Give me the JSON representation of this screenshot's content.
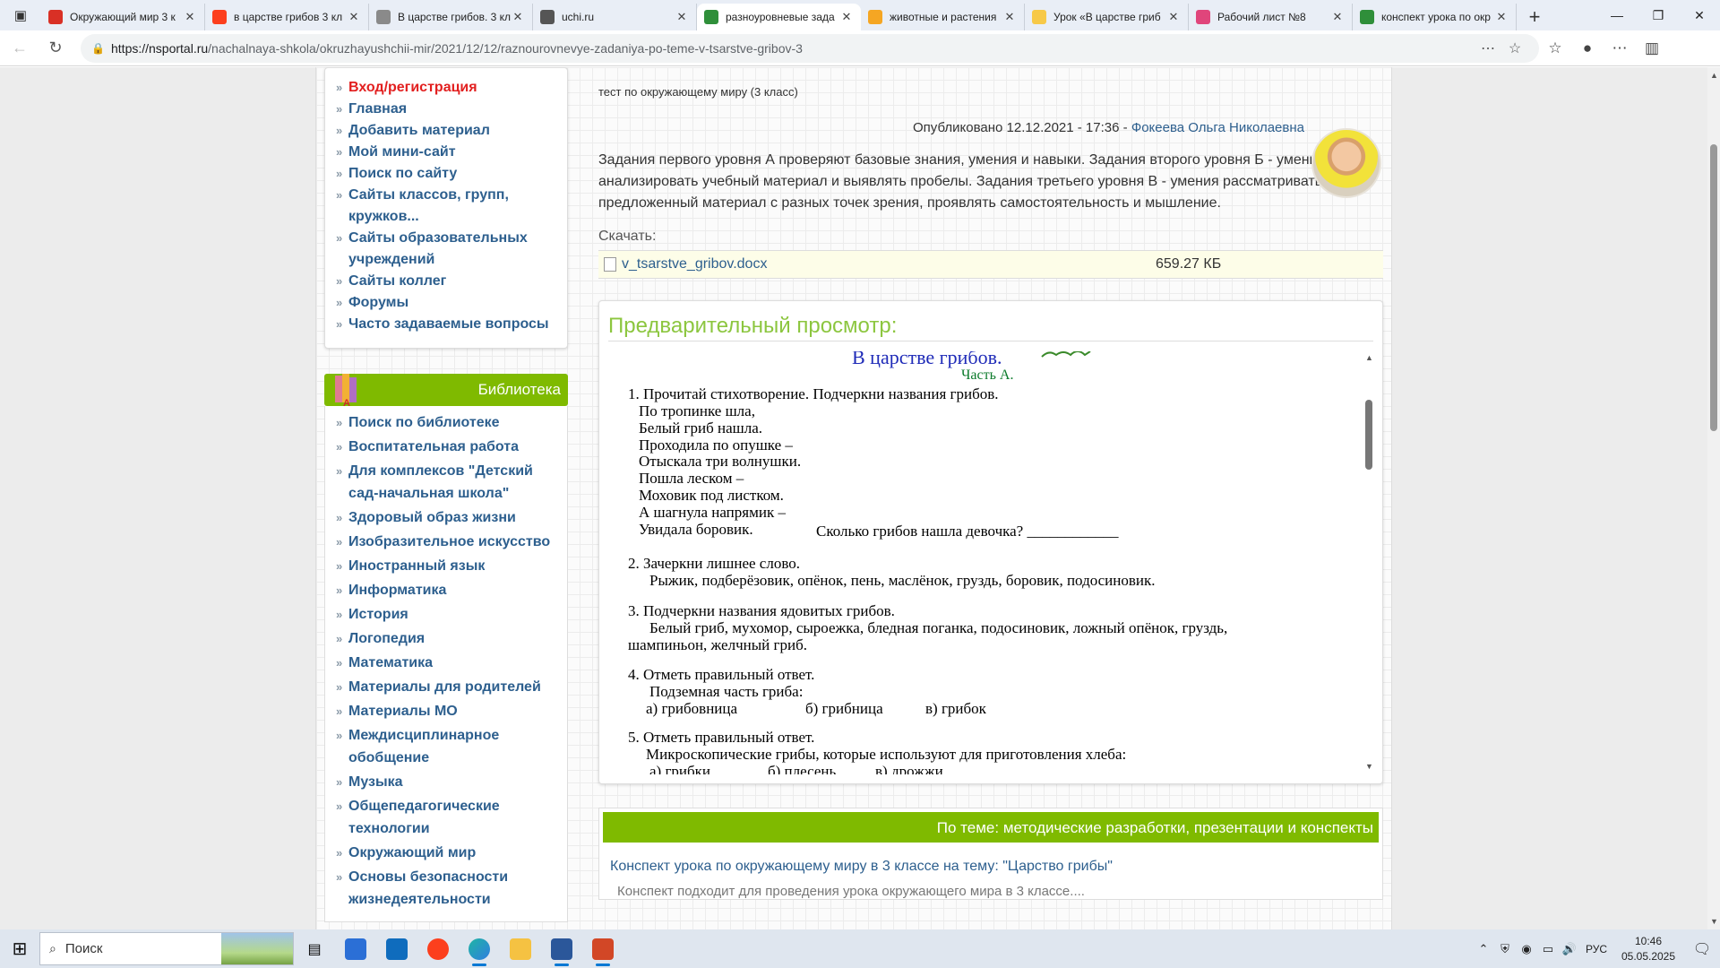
{
  "browser": {
    "tabs": [
      {
        "title": "Окружающий мир 3 к",
        "color": "#d93025",
        "active": false
      },
      {
        "title": "в царстве грибов 3 кл",
        "color": "#fc3f1d",
        "active": false
      },
      {
        "title": "В царстве грибов. 3 кл",
        "color": "#8a8a8a",
        "active": false
      },
      {
        "title": "uchi.ru",
        "color": "#555555",
        "active": false
      },
      {
        "title": "разноуровневые зада",
        "color": "#2f8f3a",
        "active": true
      },
      {
        "title": "животные и растения",
        "color": "#f5a623",
        "active": false
      },
      {
        "title": "Урок «В царстве гриб",
        "color": "#f7c948",
        "active": false
      },
      {
        "title": "Рабочий лист №8",
        "color": "#e0457b",
        "active": false
      },
      {
        "title": "конспект урока по окр",
        "color": "#2f8f3a",
        "active": false
      }
    ],
    "url_host": "https://nsportal.ru",
    "url_path": "/nachalnaya-shkola/okruzhayushchii-mir/2021/12/12/raznourovnevye-zadaniya-po-teme-v-tsarstve-gribov-3"
  },
  "sidebar": {
    "menu": [
      "Вход/регистрация",
      "Главная",
      "Добавить материал",
      "Мой мини-сайт",
      "Поиск по сайту",
      "Сайты классов, групп,",
      "кружков...",
      "Сайты образовательных",
      "учреждений",
      "Сайты коллег",
      "Форумы",
      "Часто задаваемые вопросы"
    ],
    "library_title": "Библиотека",
    "library": [
      "Поиск по библиотеке",
      "Воспитательная работа",
      "Для комплексов \"Детский сад-начальная школа\"",
      "Здоровый образ жизни",
      "Изобразительное искусство",
      "Иностранный язык",
      "Информатика",
      "История",
      "Логопедия",
      "Математика",
      "Материалы для родителей",
      "Материалы МО",
      "Междисциплинарное обобщение",
      "Музыка",
      "Общепедагогические технологии",
      "Окружающий мир",
      "Основы безопасности жизнедеятельности"
    ]
  },
  "main": {
    "subtitle": "тест по окружающему миру (3 класс)",
    "published": "Опубликовано 12.12.2021 - 17:36 - ",
    "author": "Фокеева Ольга Николаевна",
    "description": "Задания первого уровня А проверяют базовые знания, умения и навыки. Задания второго уровня Б - умения анализировать учебный материал и выявлять пробелы. Задания третьего уровня В - умения рассматривать предложенный материал с разных точек зрения, проявлять самостоятельность и мышление.",
    "download_label": "Скачать:",
    "file_name": "v_tsarstve_gribov.docx",
    "file_size": "659.27 КБ",
    "preview_title": "Предварительный просмотр:",
    "doc": {
      "title": "В царстве грибов.",
      "part": "Часть А.",
      "q1": "1. Прочитай стихотворение. Подчеркни названия грибов.",
      "poem": [
        "По тропинке шла,",
        "Белый гриб нашла.",
        "Проходила по опушке –",
        "Отыскала три волнушки.",
        "Пошла леском –",
        "Моховик под листком.",
        "А шагнула напрямик –",
        "Увидала боровик."
      ],
      "q1_tail": "Сколько грибов нашла девочка? ____________",
      "q2": "2. Зачеркни лишнее слово.",
      "q2_text": "Рыжик, подберёзовик, опёнок, пень, маслёнок, груздь, боровик, подосиновик.",
      "q3": "3. Подчеркни названия ядовитых грибов.",
      "q3_text": "Белый гриб, мухомор, сыроежка, бледная поганка, подосиновик, ложный опёнок, груздь,",
      "q3_text2": "шампиньон, желчный гриб.",
      "q4": "4. Отметь правильный ответ.",
      "q4_text": "Подземная часть гриба:",
      "q4_a": "а) грибовница",
      "q4_b": "б) грибница",
      "q4_c": "в) грибок",
      "q5": "5. Отметь правильный ответ.",
      "q5_text": "Микроскопические грибы, которые используют для приготовления хлеба:",
      "q5_a": "а) грибки",
      "q5_b": "б) плесень",
      "q5_c": "в) дрожжи"
    },
    "topic_title": "По теме: методические разработки, презентации и конспекты",
    "topic_link": "Конспект урока по окружающему миру в 3 классе на тему: \"Царство грибы\"",
    "topic_desc": "Конспект подходит для проведения урока окружающего мира в 3 классе...."
  },
  "taskbar": {
    "search_placeholder": "Поиск",
    "lang": "РУС",
    "time": "10:46",
    "date": "05.05.2025"
  }
}
